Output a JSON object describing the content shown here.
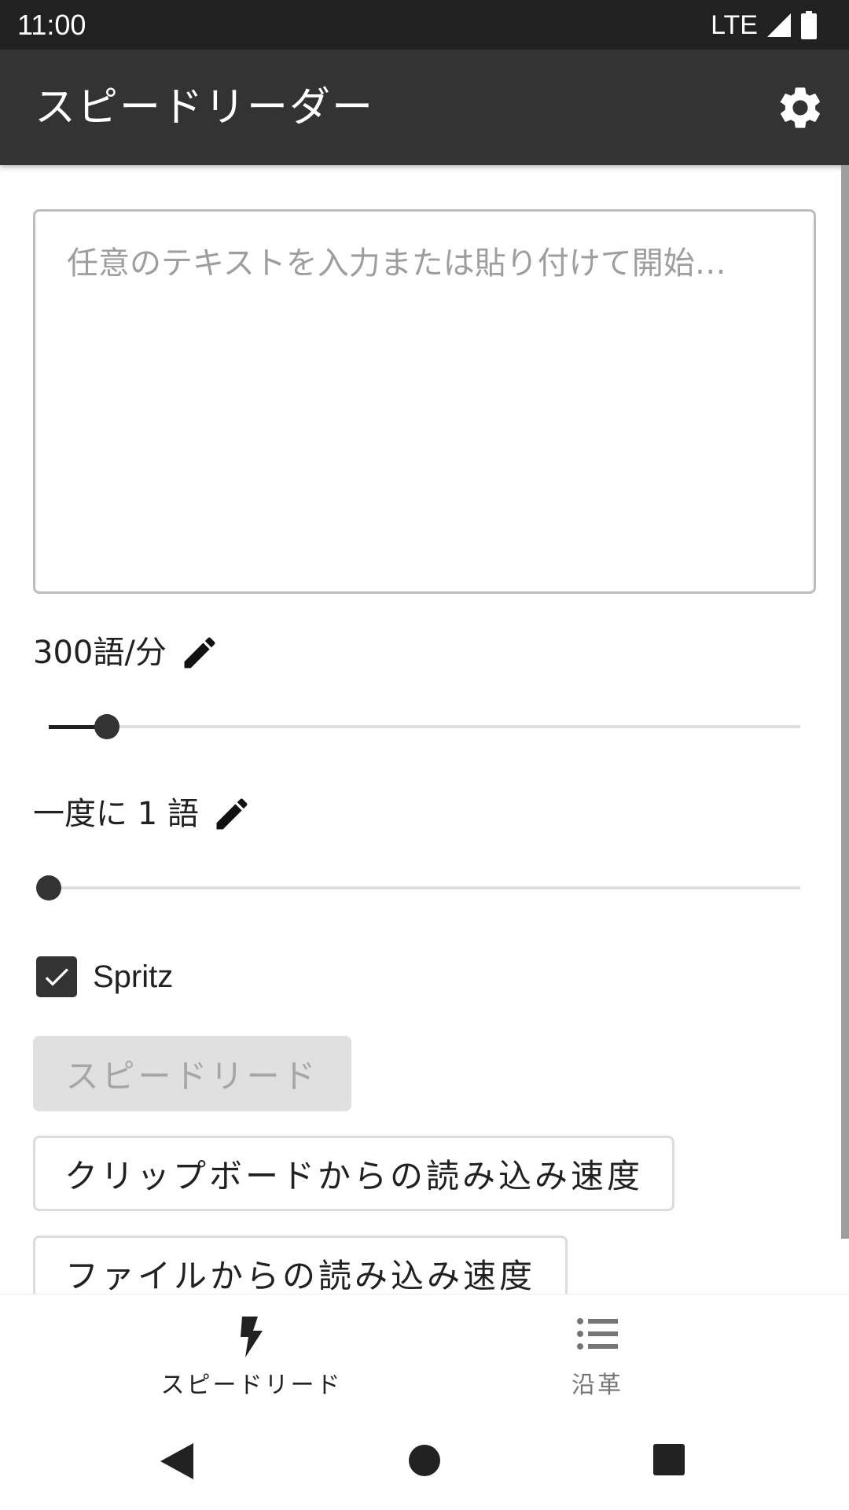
{
  "status_bar": {
    "time": "11:00",
    "network": "LTE"
  },
  "app_bar": {
    "title": "スピードリーダー",
    "settings_icon": "gear-icon"
  },
  "text_input": {
    "placeholder": "任意のテキストを入力または貼り付けて開始…",
    "value": ""
  },
  "speed": {
    "label": "300語/分",
    "edit_icon": "pencil-icon",
    "slider_fraction": 0.08
  },
  "words_at_once": {
    "label": "一度に 1 語",
    "edit_icon": "pencil-icon",
    "slider_fraction": 0.0
  },
  "spritz": {
    "label": "Spritz",
    "checked": true
  },
  "buttons": {
    "speed_read": "スピードリード",
    "read_clipboard": "クリップボードからの読み込み速度",
    "read_file": "ファイルからの読み込み速度"
  },
  "bottom_nav": {
    "items": [
      {
        "label": "スピードリード",
        "icon": "bolt-icon",
        "active": true
      },
      {
        "label": "沿革",
        "icon": "list-icon",
        "active": false
      }
    ]
  },
  "system_nav": {
    "back": "back-icon",
    "home": "home-icon",
    "recents": "recents-icon"
  },
  "colors": {
    "app_bar": "#333333",
    "status_bar": "#212121",
    "accent": "#333333"
  }
}
